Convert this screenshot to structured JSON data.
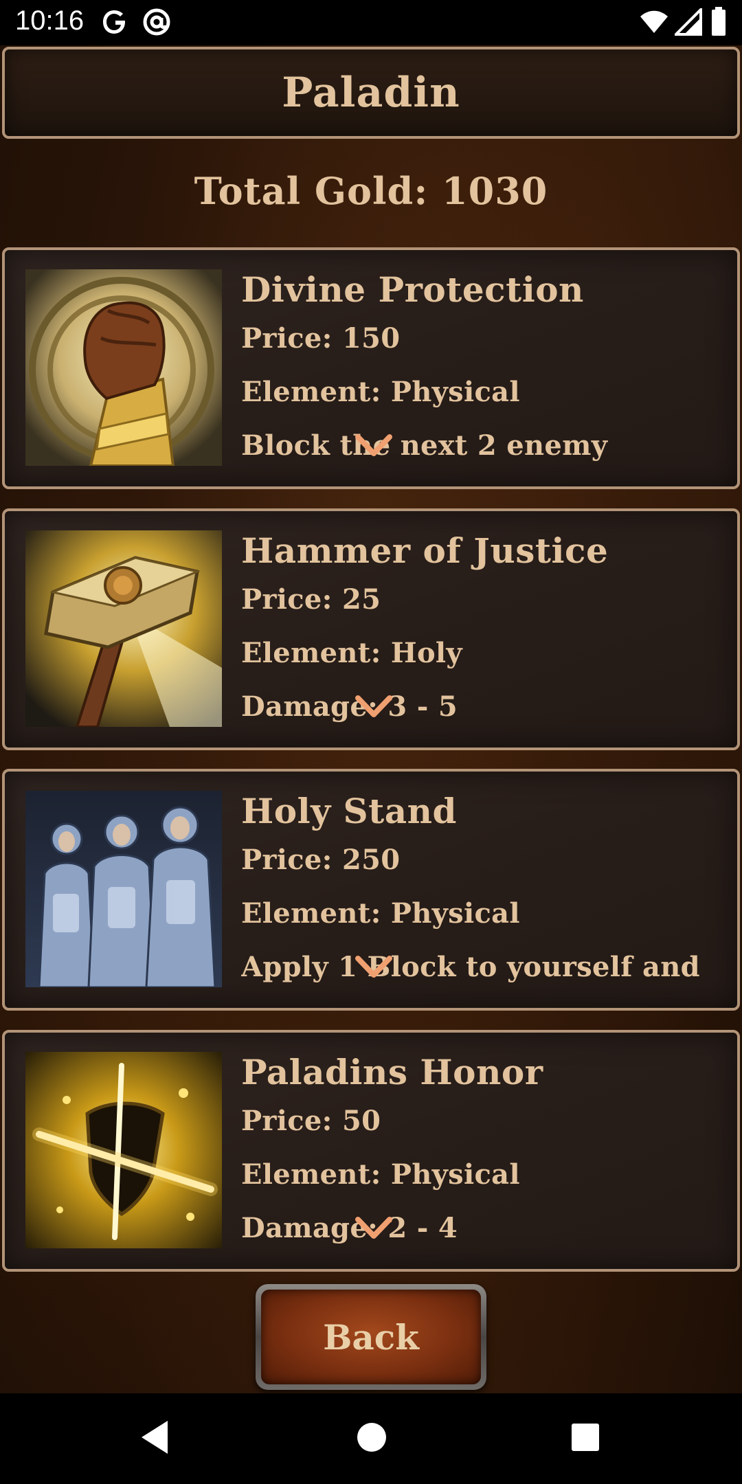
{
  "status_bar": {
    "time": "10:16"
  },
  "header": {
    "title": "Paladin"
  },
  "gold": {
    "text": "Total Gold: 1030"
  },
  "cards": [
    {
      "name": "Divine Protection",
      "price": "Price: 150",
      "element": "Element: Physical",
      "detail": "Block the next 2 enemy",
      "icon": "fist-icon"
    },
    {
      "name": "Hammer of Justice",
      "price": "Price: 25",
      "element": "Element: Holy",
      "detail": "Damage: 3 - 5",
      "icon": "hammer-icon"
    },
    {
      "name": "Holy Stand",
      "price": "Price: 250",
      "element": "Element: Physical",
      "detail": "Apply 1 Block to yourself and",
      "icon": "knights-icon"
    },
    {
      "name": "Paladins Honor",
      "price": "Price: 50",
      "element": "Element: Physical",
      "detail": "Damage: 2 - 4",
      "icon": "shield-icon"
    }
  ],
  "back_button": {
    "label": "Back"
  },
  "colors": {
    "text": "#e2c39d",
    "border": "#b39478",
    "chevron": "#f0a070",
    "button": "#7a2f10"
  }
}
